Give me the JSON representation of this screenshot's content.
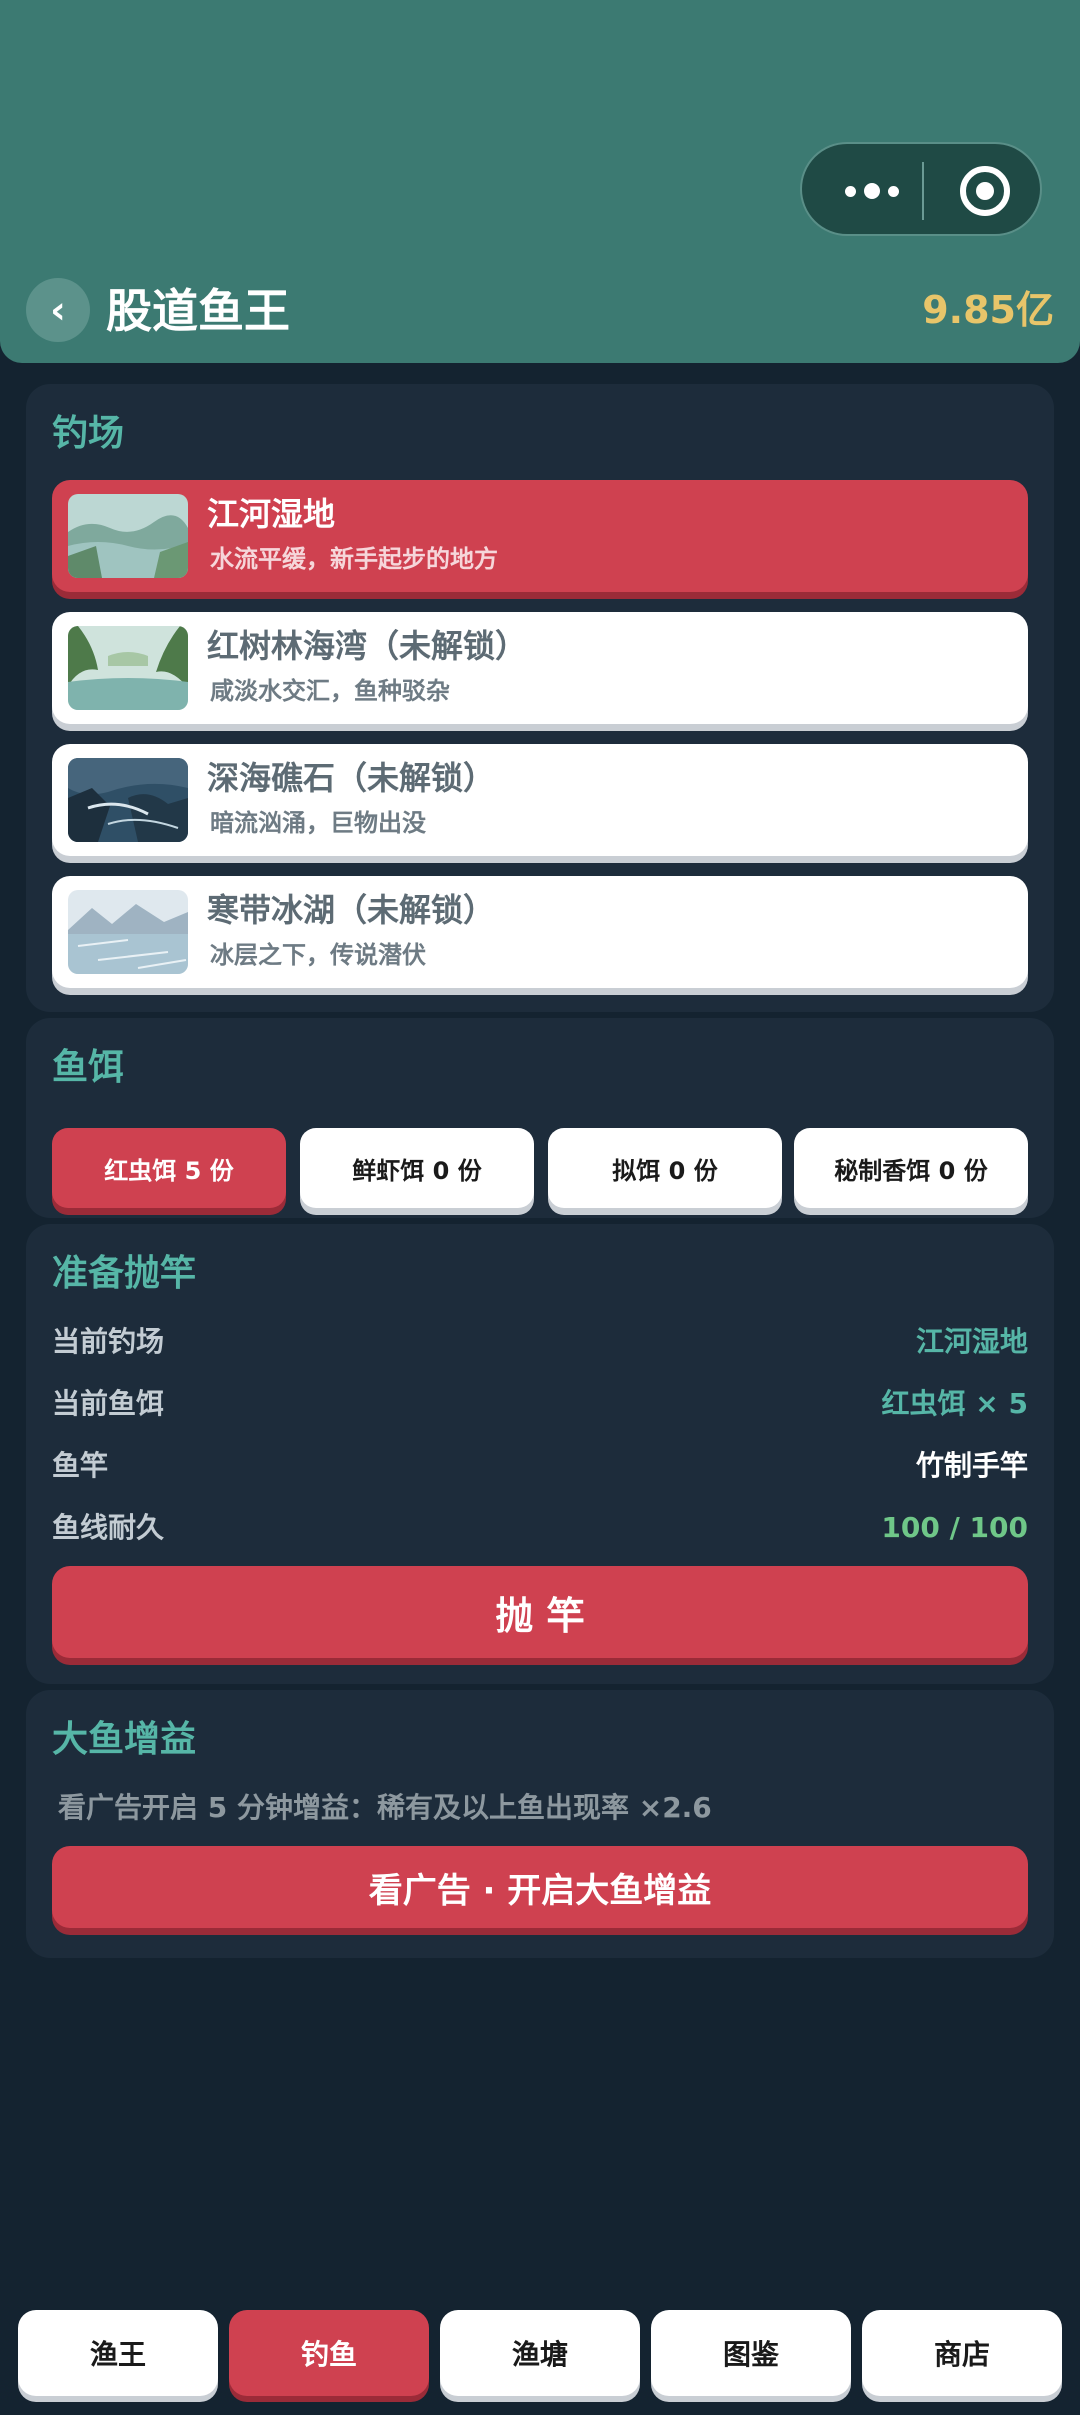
{
  "header": {
    "back_icon": "‹",
    "title": "股道鱼王",
    "balance": "9.85亿",
    "menu_icon": "more-dots-icon",
    "close_icon": "target-icon"
  },
  "spots_panel": {
    "title": "钓场",
    "items": [
      {
        "name": "江河湿地",
        "desc": "水流平缓，新手起步的地方"
      },
      {
        "name": "红树林海湾（未解锁）",
        "desc": "咸淡水交汇，鱼种驳杂"
      },
      {
        "name": "深海礁石（未解锁）",
        "desc": "暗流汹涌，巨物出没"
      },
      {
        "name": "寒带冰湖（未解锁）",
        "desc": "冰层之下，传说潜伏"
      }
    ]
  },
  "bait_panel": {
    "title": "鱼饵",
    "items": [
      {
        "label": "红虫饵 5 份"
      },
      {
        "label": "鲜虾饵 0 份"
      },
      {
        "label": "拟饵 0 份"
      },
      {
        "label": "秘制香饵 0 份"
      }
    ]
  },
  "cast_panel": {
    "title": "准备抛竿",
    "rows": [
      {
        "label": "当前钓场",
        "value": "江河湿地",
        "color": "#56b6a7"
      },
      {
        "label": "当前鱼饵",
        "value": "红虫饵 × 5",
        "color": "#56b6a7"
      },
      {
        "label": "鱼竿",
        "value": "竹制手竿",
        "color": "#ffffff"
      },
      {
        "label": "鱼线耐久",
        "value": "100 / 100",
        "color": "#6fc788"
      }
    ],
    "cast_button": "抛 竿"
  },
  "buff_panel": {
    "title": "大鱼增益",
    "desc": "看广告开启 5 分钟增益：稀有及以上鱼出现率 ×2.6",
    "button": "看广告 · 开启大鱼增益"
  },
  "nav": {
    "items": [
      {
        "label": "渔王"
      },
      {
        "label": "钓鱼"
      },
      {
        "label": "渔塘"
      },
      {
        "label": "图鉴"
      },
      {
        "label": "商店"
      }
    ]
  },
  "colors": {
    "header_bg": "#3c7a72",
    "page_bg": "#142330",
    "panel_bg": "#1d2c3b",
    "accent_red": "#cf4150",
    "accent_teal": "#56b6a7",
    "gold": "#e8c56a"
  }
}
